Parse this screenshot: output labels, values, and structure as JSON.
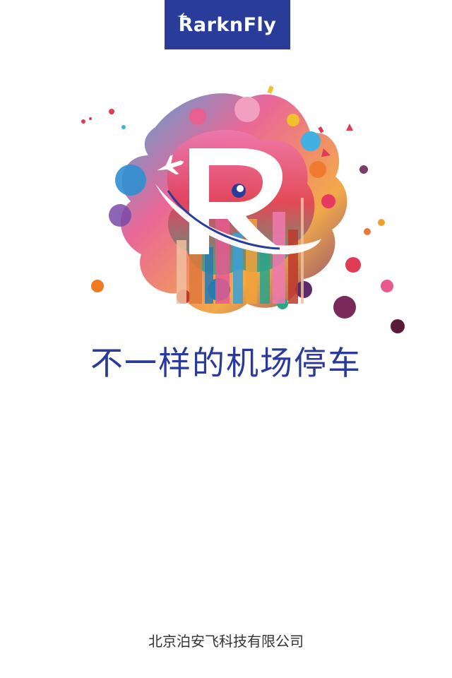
{
  "brand": {
    "logo_text": "RarknFly",
    "badge_color": "#2a3c99",
    "icon": "airplane-icon"
  },
  "splash": {
    "art": "paint-splash-R-logo",
    "icon": "airplane-icon"
  },
  "tagline": "不一样的机场停车",
  "footer": {
    "company": "北京泊安飞科技有限公司"
  },
  "colors": {
    "tagline": "#2a3a9c",
    "footer_text": "#333333",
    "background": "#ffffff"
  }
}
